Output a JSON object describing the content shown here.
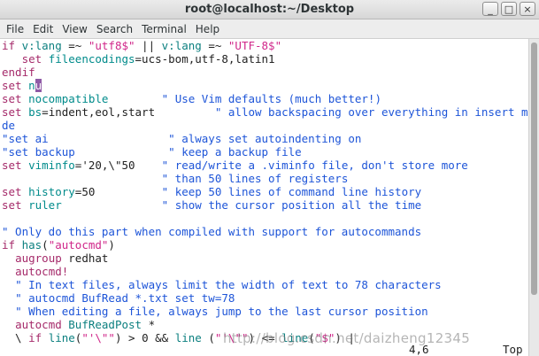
{
  "window": {
    "title": "root@localhost:~/Desktop"
  },
  "window_controls": {
    "minimize": "_",
    "maximize": "□",
    "close": "×"
  },
  "menubar": [
    "File",
    "Edit",
    "View",
    "Search",
    "Terminal",
    "Help"
  ],
  "editor": {
    "lines": [
      [
        {
          "t": "if ",
          "c": "kw"
        },
        {
          "t": "v:lang",
          "c": "ident"
        },
        {
          "t": " =~ ",
          "c": "txt"
        },
        {
          "t": "\"utf8$\"",
          "c": "str"
        },
        {
          "t": " || ",
          "c": "txt"
        },
        {
          "t": "v:lang",
          "c": "ident"
        },
        {
          "t": " =~ ",
          "c": "txt"
        },
        {
          "t": "\"UTF-8$\"",
          "c": "str"
        }
      ],
      [
        {
          "t": "   ",
          "c": "txt"
        },
        {
          "t": "set ",
          "c": "kw"
        },
        {
          "t": "fileencodings",
          "c": "opt"
        },
        {
          "t": "=ucs-bom,utf-8,latin1",
          "c": "txt"
        }
      ],
      [
        {
          "t": "endif",
          "c": "kw"
        }
      ],
      [
        {
          "t": "set ",
          "c": "kw"
        },
        {
          "t": "n",
          "c": "opt"
        },
        {
          "t": "u",
          "c": "cursor"
        }
      ],
      [
        {
          "t": "set ",
          "c": "kw"
        },
        {
          "t": "nocompatible",
          "c": "opt"
        },
        {
          "t": "        ",
          "c": "txt"
        },
        {
          "t": "\" Use Vim defaults (much better!)",
          "c": "cmt"
        }
      ],
      [
        {
          "t": "set ",
          "c": "kw"
        },
        {
          "t": "bs",
          "c": "opt"
        },
        {
          "t": "=indent,eol,start",
          "c": "txt"
        },
        {
          "t": "         ",
          "c": "txt"
        },
        {
          "t": "\" allow backspacing over everything in insert mo",
          "c": "cmt"
        }
      ],
      [
        {
          "t": "de",
          "c": "cmt"
        }
      ],
      [
        {
          "t": "\"set ai                  \" always set autoindenting on",
          "c": "cmt"
        }
      ],
      [
        {
          "t": "\"set backup              \" keep a backup file",
          "c": "cmt"
        }
      ],
      [
        {
          "t": "set ",
          "c": "kw"
        },
        {
          "t": "viminfo",
          "c": "opt"
        },
        {
          "t": "='20,\\\"50",
          "c": "txt"
        },
        {
          "t": "    ",
          "c": "txt"
        },
        {
          "t": "\" read/write a .viminfo file, don't store more",
          "c": "cmt"
        }
      ],
      [
        {
          "t": "                        ",
          "c": "txt"
        },
        {
          "t": "\" than 50 lines of registers",
          "c": "cmt"
        }
      ],
      [
        {
          "t": "set ",
          "c": "kw"
        },
        {
          "t": "history",
          "c": "opt"
        },
        {
          "t": "=50",
          "c": "txt"
        },
        {
          "t": "          ",
          "c": "txt"
        },
        {
          "t": "\" keep 50 lines of command line history",
          "c": "cmt"
        }
      ],
      [
        {
          "t": "set ",
          "c": "kw"
        },
        {
          "t": "ruler",
          "c": "opt"
        },
        {
          "t": "               ",
          "c": "txt"
        },
        {
          "t": "\" show the cursor position all the time",
          "c": "cmt"
        }
      ],
      [],
      [
        {
          "t": "\" Only do this part when compiled with support for autocommands",
          "c": "cmt"
        }
      ],
      [
        {
          "t": "if ",
          "c": "kw"
        },
        {
          "t": "has",
          "c": "ident"
        },
        {
          "t": "(",
          "c": "txt"
        },
        {
          "t": "\"autocmd\"",
          "c": "str"
        },
        {
          "t": ")",
          "c": "txt"
        }
      ],
      [
        {
          "t": "  ",
          "c": "txt"
        },
        {
          "t": "augroup",
          "c": "kw"
        },
        {
          "t": " redhat",
          "c": "txt"
        }
      ],
      [
        {
          "t": "  ",
          "c": "txt"
        },
        {
          "t": "autocmd!",
          "c": "kw"
        }
      ],
      [
        {
          "t": "  ",
          "c": "txt"
        },
        {
          "t": "\" In text files, always limit the width of text to 78 characters",
          "c": "cmt"
        }
      ],
      [
        {
          "t": "  ",
          "c": "txt"
        },
        {
          "t": "\" autocmd BufRead *.txt set tw=78",
          "c": "cmt"
        }
      ],
      [
        {
          "t": "  ",
          "c": "txt"
        },
        {
          "t": "\" When editing a file, always jump to the last cursor position",
          "c": "cmt"
        }
      ],
      [
        {
          "t": "  ",
          "c": "txt"
        },
        {
          "t": "autocmd",
          "c": "kw"
        },
        {
          "t": " ",
          "c": "txt"
        },
        {
          "t": "BufReadPost",
          "c": "ident"
        },
        {
          "t": " *",
          "c": "txt"
        }
      ],
      [
        {
          "t": "  \\ ",
          "c": "txt"
        },
        {
          "t": "if ",
          "c": "kw"
        },
        {
          "t": "line",
          "c": "ident"
        },
        {
          "t": "(",
          "c": "txt"
        },
        {
          "t": "\"'\\\"\"",
          "c": "str"
        },
        {
          "t": ") > 0 && ",
          "c": "txt"
        },
        {
          "t": "line",
          "c": "ident"
        },
        {
          "t": " (",
          "c": "txt"
        },
        {
          "t": "\"'\\\"\"",
          "c": "str"
        },
        {
          "t": ") <= ",
          "c": "txt"
        },
        {
          "t": "line",
          "c": "ident"
        },
        {
          "t": "(",
          "c": "txt"
        },
        {
          "t": "\"$\"",
          "c": "str"
        },
        {
          "t": ") |",
          "c": "txt"
        }
      ]
    ]
  },
  "status": {
    "position": "4,6",
    "scroll": "Top"
  },
  "watermark": "http://blog.csdn.net/daizheng12345",
  "colors": {
    "keyword": "#a52a6a",
    "string": "#d0278a",
    "comment": "#1e55d8",
    "option": "#008b8b",
    "cursor": "#8f5aa6"
  }
}
